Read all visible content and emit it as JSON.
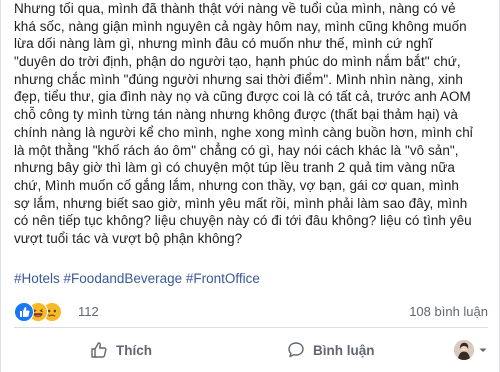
{
  "post": {
    "lines": [
      "Nhưng tối qua, mình đã thành thật với nàng về tuổi của mình, nàng có vẻ",
      "khá sốc, nàng giận mình nguyên cả ngày hôm nay, mình cũng không muốn",
      "lừa dối nàng làm gì, nhưng mình đâu có muốn như thế, mình cứ nghĩ",
      "\"duyên do trời định, phận do người tạo, hạnh phúc do mình nắm bắt\" chứ,",
      "nhưng chắc mình \"đúng người nhưng sai thời điểm\". Mình nhìn nàng, xinh",
      "đẹp, tiểu thư, gia đình này nọ và cũng được coi là có tất cả, trước anh AOM",
      "chỗ công ty mình từng tán nàng nhưng không được (thất bại thảm hại) và",
      "chính nàng là người kể cho mình, nghe xong mình càng buồn hơn, mình chỉ",
      "là một thằng \"khố rách áo ôm\" chẳng có gì, hay nói cách khác là \"vô sản\",",
      "nhưng bây giờ thì làm gì có chuyện một túp lều tranh 2 quả tim vàng nữa",
      "chứ, Mình muốn cố gắng lắm, nhưng con thầy, vợ bạn, gái cơ quan, mình",
      "sợ lắm, nhưng biết sao giờ, mình yêu mất rồi, mình phải làm sao đây, mình",
      "có nên tiếp tục không? liệu chuyện này có đi tới đâu không? liệu có tình yêu",
      "vượt tuổi tác và vượt bộ phận không?"
    ],
    "hashtags": [
      "#Hotels",
      "#FoodandBeverage",
      "#FrontOffice"
    ]
  },
  "reactions": {
    "icons": [
      "like-icon",
      "haha-icon",
      "sad-icon"
    ],
    "count": "112",
    "comments": "108 bình luận"
  },
  "actions": {
    "like_label": "Thích",
    "comment_label": "Bình luận"
  },
  "colors": {
    "like_blue": "#1877f2",
    "haha_yellow": "#f7b928",
    "hashtag_blue": "#385898",
    "secondary_text": "#606770"
  }
}
